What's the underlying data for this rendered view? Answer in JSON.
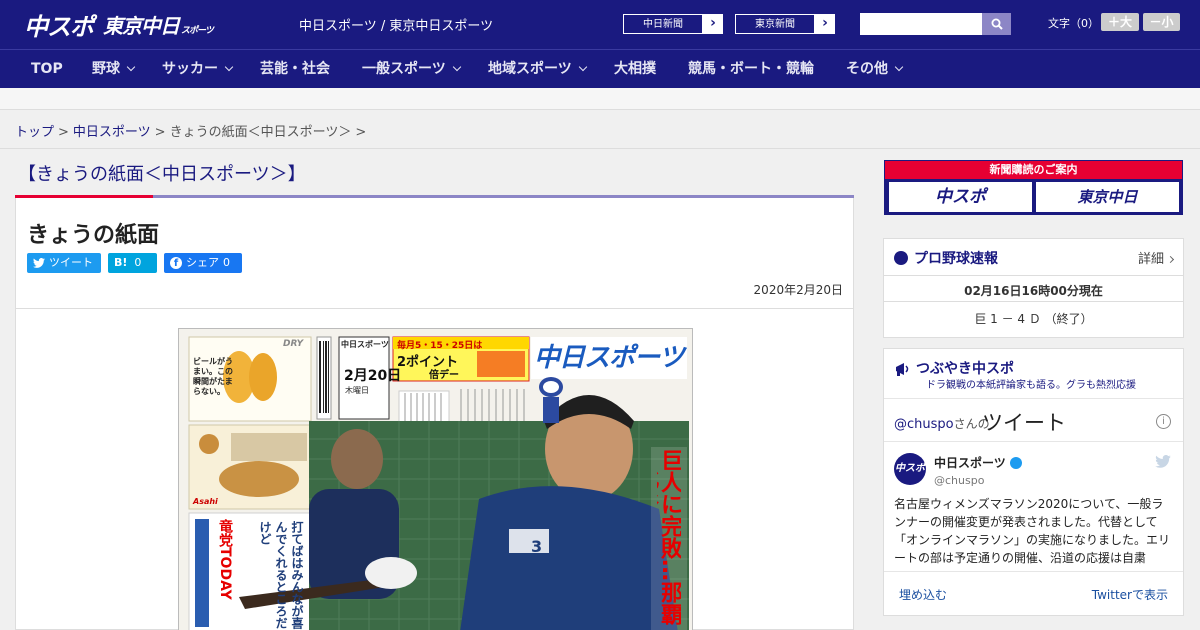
{
  "header": {
    "logo_primary": "中スポ",
    "logo_secondary": "東京中日",
    "logo_secondary_small": "スポーツ",
    "site_name": "中日スポーツ / 東京中日スポーツ",
    "ext_links": [
      "中日新聞",
      "東京新聞"
    ],
    "search_placeholder": "",
    "font_label": "文字（0）",
    "font_bigger": "＋大",
    "font_smaller": "－小"
  },
  "nav": {
    "items": [
      {
        "label": "TOP",
        "has_menu": false
      },
      {
        "label": "野球",
        "has_menu": true
      },
      {
        "label": "サッカー",
        "has_menu": true
      },
      {
        "label": "芸能・社会",
        "has_menu": false
      },
      {
        "label": "一般スポーツ",
        "has_menu": true
      },
      {
        "label": "地域スポーツ",
        "has_menu": true
      },
      {
        "label": "大相撲",
        "has_menu": false
      },
      {
        "label": "競馬・ボート・競輪",
        "has_menu": false
      },
      {
        "label": "その他",
        "has_menu": true
      }
    ]
  },
  "breadcrumb": {
    "items": [
      "トップ",
      "中日スポーツ",
      "きょうの紙面＜中日スポーツ＞"
    ],
    "separator": ">"
  },
  "main": {
    "section_title": "【きょうの紙面＜中日スポーツ＞】",
    "article_title": "きょうの紙面",
    "share": {
      "tweet": "ツイート",
      "hatena": "B!",
      "hatena_count": "0",
      "facebook": "シェア",
      "facebook_count": "0"
    },
    "date": "2020年2月20日"
  },
  "newspaper": {
    "masthead": "中日スポーツ",
    "date_box_name": "中日スポーツ",
    "date_box_date": "2月20日",
    "date_box_weekday": "木曜日",
    "ad_top": "ビールがうまい。この瞬間がたまらない。",
    "ad_brand": "DRY",
    "point_line1": "毎月5・15・25日は",
    "point_line2": "2ポイント",
    "point_line3": "倍デー",
    "headline": "巨人に完敗…那覇→北谷",
    "sub_headline": "竜党TODAY",
    "sub_text": "打てばはみんなが喜んでくれるところだけど",
    "player_number": "3",
    "company": "Asahi"
  },
  "sidebar": {
    "subscribe_title": "新聞購読のご案内",
    "subscribe_buttons": [
      "中スポ",
      "東京中日"
    ],
    "baseball": {
      "title": "プロ野球速報",
      "detail": "詳細",
      "time": "02月16日16時00分現在",
      "score": "巨 1 － 4 Ｄ （終了）"
    },
    "twitter": {
      "title": "つぶやき中スポ",
      "subtitle": "ドラ観戦の本紙評論家も語る。グラも熱烈応援",
      "handle": "@chuspo",
      "handle_suffix": "さんの",
      "tweets_word": "ツイート",
      "info": "i",
      "display_name": "中日スポーツ",
      "username": "@chuspo",
      "avatar": "中スポ",
      "text": "名古屋ウィメンズマラソン2020について、一般ランナーの開催変更が発表されました。代替として「オンラインマラソン」の実施になりました。エリートの部は予定通りの開催、沿道の応援は自粛",
      "embed": "埋め込む",
      "view_on": "Twitterで表示"
    }
  },
  "colors": {
    "brand": "#1a1a80",
    "accent_red": "#e60033",
    "rule": "#8c86c6",
    "twitter": "#1d9bf0"
  }
}
